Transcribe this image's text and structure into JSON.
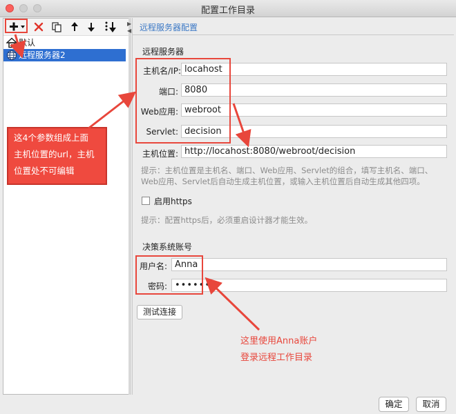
{
  "window": {
    "title": "配置工作目录"
  },
  "toolbar": {
    "add_icon": "plus-dropdown-icon",
    "delete_icon": "red-x-icon",
    "copy_icon": "copy-icon",
    "up_icon": "arrow-up-icon",
    "down_icon": "arrow-down-icon",
    "sort_icon": "sort-down-icon"
  },
  "tree": {
    "items": [
      {
        "label": "默认",
        "icon": "home-icon"
      },
      {
        "label": "远程服务器2",
        "icon": "globe-icon",
        "selected": true
      }
    ]
  },
  "panel": {
    "title": "远程服务器配置",
    "section_server": "远程服务器",
    "host_label": "主机名/IP:",
    "host_value": "locahost",
    "port_label": "端口:",
    "port_value": "8080",
    "webapp_label": "Web应用:",
    "webapp_value": "webroot",
    "servlet_label": "Servlet:",
    "servlet_value": "decision",
    "location_label": "主机位置:",
    "location_value": "http://locahost:8080/webroot/decision",
    "hint1_line1": "提示：主机位置是主机名、端口、Web应用、Servlet的组合，填写主机名、端口、",
    "hint1_line2": "Web应用、Servlet后自动生成主机位置，或输入主机位置后自动生成其他四项。",
    "https_label": "启用https",
    "hint2": "提示：配置https后，必须重启设计器才能生效。",
    "section_account": "决策系统账号",
    "user_label": "用户名:",
    "user_value": "Anna",
    "password_label": "密码:",
    "password_value": "••••••",
    "test_button": "测试连接"
  },
  "annotations": {
    "left_note": [
      "这4个参数组成上面",
      "主机位置的url，主机",
      "位置处不可编辑"
    ],
    "right_note": [
      "这里使用Anna账户",
      "登录远程工作目录"
    ],
    "accent_color": "#e8463b"
  },
  "footer": {
    "ok": "确定",
    "cancel": "取消"
  }
}
